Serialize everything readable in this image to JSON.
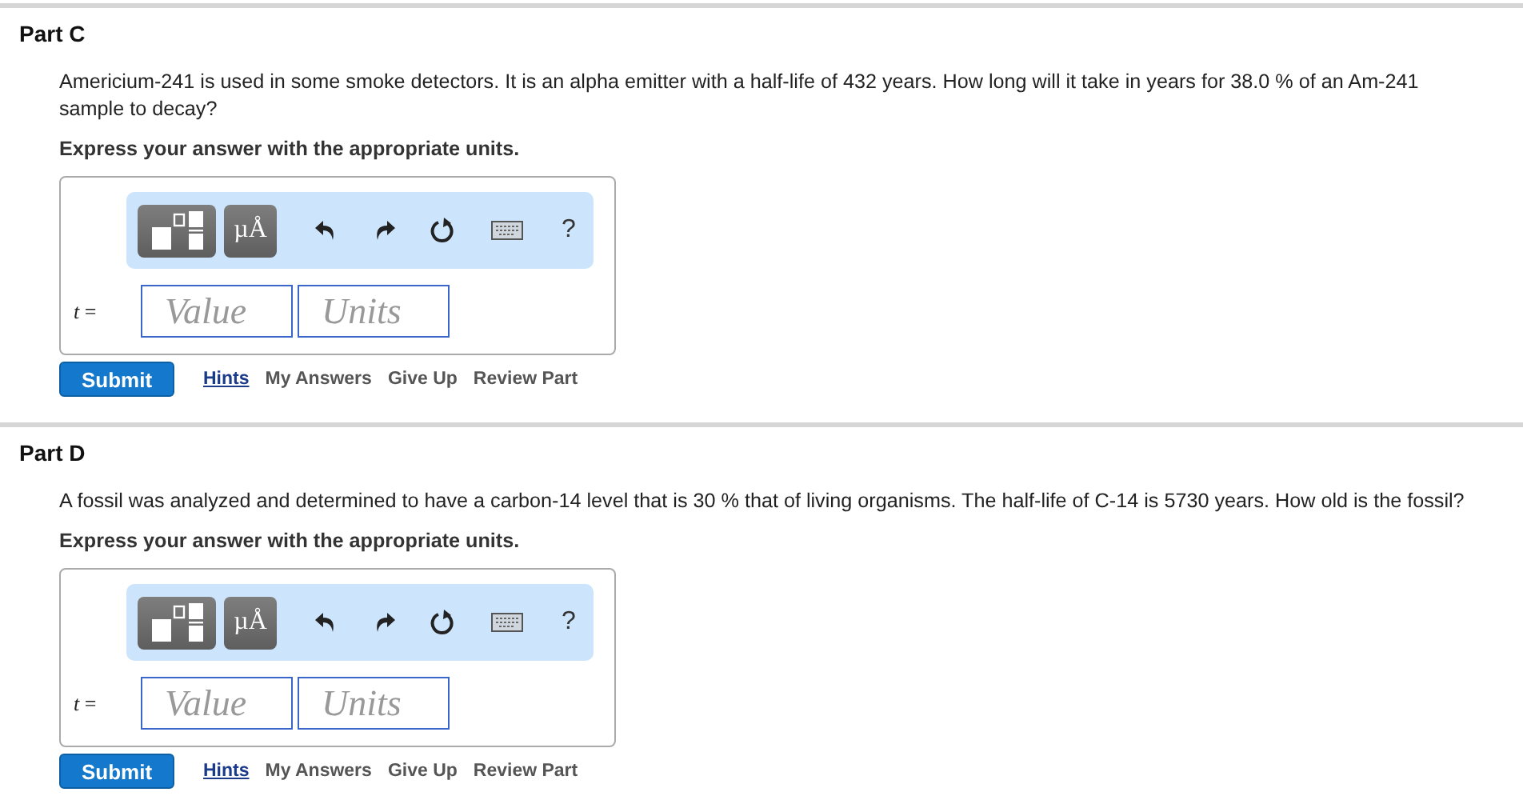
{
  "parts": [
    {
      "title": "Part C",
      "question": "Americium-241 is used in some smoke detectors. It is an alpha emitter with a half-life of 432 years. How long will it take in years for 38.0 % of an Am-241 sample to decay?",
      "instruction": "Express your answer with the appropriate units.",
      "units_button": "µÅ",
      "help_button": "?",
      "variable": "*t* =",
      "value_placeholder": "Value",
      "units_placeholder": "Units",
      "submit": "Submit",
      "links": [
        {
          "label": "Hints",
          "kind": "link"
        },
        {
          "label": "My Answers",
          "kind": "action"
        },
        {
          "label": "Give Up",
          "kind": "action"
        },
        {
          "label": "Review Part",
          "kind": "action"
        }
      ]
    },
    {
      "title": "Part D",
      "question": "A fossil was analyzed and determined to have a carbon-14 level that is 30 % that of living organisms. The half-life of C-14 is 5730 years. How old is the fossil?",
      "instruction": "Express your answer with the appropriate units.",
      "units_button": "µÅ",
      "help_button": "?",
      "variable": "*t* =",
      "value_placeholder": "Value",
      "units_placeholder": "Units",
      "submit": "Submit",
      "links": [
        {
          "label": "Hints",
          "kind": "link"
        },
        {
          "label": "My Answers",
          "kind": "action"
        },
        {
          "label": "Give Up",
          "kind": "action"
        },
        {
          "label": "Review Part",
          "kind": "action"
        }
      ]
    }
  ]
}
